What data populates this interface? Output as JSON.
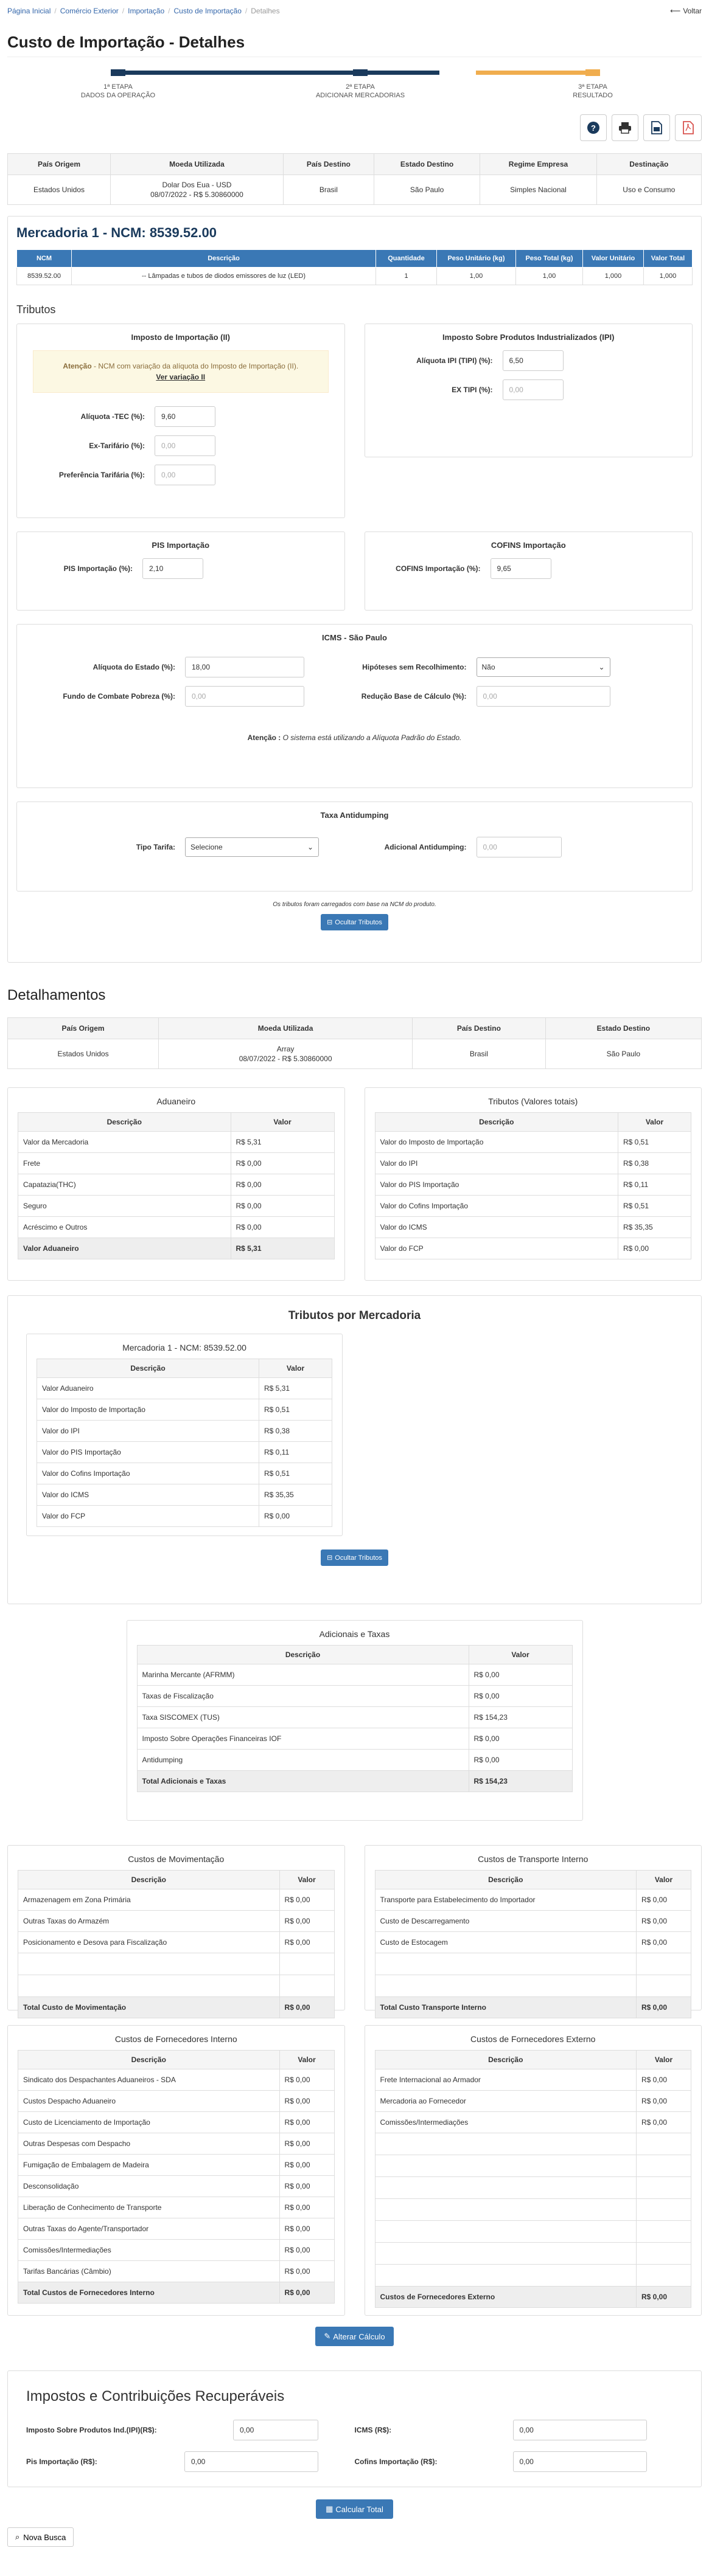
{
  "breadcrumb": [
    "Página Inicial",
    "Comércio Exterior",
    "Importação",
    "Custo de Importação",
    "Detalhes"
  ],
  "voltar_label": "Voltar",
  "page_title": "Custo de Importação - Detalhes",
  "steps": [
    {
      "step": "1ª ETAPA",
      "label": "DADOS DA OPERAÇÃO"
    },
    {
      "step": "2ª ETAPA",
      "label": "ADICIONAR MERCADORIAS"
    },
    {
      "step": "3ª ETAPA",
      "label": "RESULTADO"
    }
  ],
  "colors": {
    "step_done": "#1a3a5c",
    "step_current": "#f0ad4e",
    "primary": "#3a78b5",
    "pdf": "#d9534f"
  },
  "toolbar_icons": [
    "help-icon",
    "print-icon",
    "document-icon",
    "pdf-icon"
  ],
  "operation": {
    "headers": [
      "País Origem",
      "Moeda Utilizada",
      "País Destino",
      "Estado Destino",
      "Regime Empresa",
      "Destinação"
    ],
    "values": [
      "Estados Unidos",
      "Dolar Dos Eua - USD",
      "08/07/2022 - R$ 5.30860000",
      "Brasil",
      "São Paulo",
      "Simples Nacional",
      "Uso e Consumo"
    ]
  },
  "mercadoria": {
    "title": "Mercadoria 1 - NCM: 8539.52.00",
    "headers": [
      "NCM",
      "Descrição",
      "Quantidade",
      "Peso Unitário (kg)",
      "Peso Total (kg)",
      "Valor Unitário",
      "Valor Total"
    ],
    "row": [
      "8539.52.00",
      "-- Lâmpadas e tubos de diodos emissores de luz (LED)",
      "1",
      "1,00",
      "1,00",
      "1,000",
      "1,000"
    ]
  },
  "tributos": {
    "title": "Tributos",
    "ii": {
      "title": "Imposto de Importação (II)",
      "warn_prefix": "Atenção",
      "warn_text": " - NCM com variação da alíquota do Imposto de Importação (II).",
      "warn_link": "Ver variação II",
      "aliquota_label": "Alíquota -TEC (%):",
      "aliquota_value": "9,60",
      "ex_label": "Ex-Tarifário (%):",
      "ex_placeholder": "0,00",
      "pref_label": "Preferência Tarifária (%):",
      "pref_placeholder": "0,00"
    },
    "ipi": {
      "title": "Imposto Sobre Produtos Industrializados (IPI)",
      "aliquota_label": "Alíquota IPI (TIPI) (%):",
      "aliquota_value": "6,50",
      "ex_label": "EX TIPI (%):",
      "ex_placeholder": "0,00"
    },
    "pis": {
      "title": "PIS Importação",
      "label": "PIS Importação (%):",
      "value": "2,10"
    },
    "cofins": {
      "title": "COFINS Importação",
      "label": "COFINS Importação (%):",
      "value": "9,65"
    },
    "icms": {
      "title": "ICMS - São Paulo",
      "aliquota_label": "Alíquota do Estado (%):",
      "aliquota_value": "18,00",
      "hipoteses_label": "Hipóteses sem Recolhimento:",
      "hipoteses_value": "Não",
      "fcp_label": "Fundo de Combate Pobreza (%):",
      "fcp_placeholder": "0,00",
      "reducao_label": "Redução Base de Cálculo (%):",
      "reducao_placeholder": "0,00",
      "note_prefix": "Atenção :",
      "note_text": " O sistema está utilizando a Alíquota Padrão do Estado."
    },
    "antidumping": {
      "title": "Taxa Antidumping",
      "tipo_label": "Tipo Tarifa:",
      "tipo_value": "Selecione",
      "adicional_label": "Adicional Antidumping:",
      "adicional_placeholder": "0,00"
    },
    "footnote": "Os tributos foram carregados com base na NCM do produto.",
    "ocultar_label": "Ocultar Tributos"
  },
  "detalhamentos": {
    "title": "Detalhamentos",
    "headers": [
      "País Origem",
      "Moeda Utilizada",
      "País Destino",
      "Estado Destino"
    ],
    "values": [
      "Estados Unidos",
      "Array",
      "08/07/2022 - R$ 5.30860000",
      "Brasil",
      "São Paulo"
    ]
  },
  "aduaneiro": {
    "title": "Aduaneiro",
    "headers": [
      "Descrição",
      "Valor"
    ],
    "rows": [
      [
        "Valor da Mercadoria",
        "R$ 5,31"
      ],
      [
        "Frete",
        "R$ 0,00"
      ],
      [
        "Capatazia(THC)",
        "R$ 0,00"
      ],
      [
        "Seguro",
        "R$ 0,00"
      ],
      [
        "Acréscimo e Outros",
        "R$ 0,00"
      ]
    ],
    "total": [
      "Valor Aduaneiro",
      "R$ 5,31"
    ]
  },
  "tributos_totais": {
    "title": "Tributos (Valores totais)",
    "headers": [
      "Descrição",
      "Valor"
    ],
    "rows": [
      [
        "Valor do Imposto de Importação",
        "R$ 0,51"
      ],
      [
        "Valor do IPI",
        "R$ 0,38"
      ],
      [
        "Valor do PIS Importação",
        "R$ 0,11"
      ],
      [
        "Valor do Cofins Importação",
        "R$ 0,51"
      ],
      [
        "Valor do ICMS",
        "R$ 35,35"
      ],
      [
        "Valor do FCP",
        "R$ 0,00"
      ]
    ]
  },
  "tributos_mercadoria": {
    "title": "Tributos por Mercadoria",
    "card_title": "Mercadoria 1 - NCM: 8539.52.00",
    "headers": [
      "Descrição",
      "Valor"
    ],
    "rows": [
      [
        "Valor Aduaneiro",
        "R$ 5,31"
      ],
      [
        "Valor do Imposto de Importação",
        "R$ 0,51"
      ],
      [
        "Valor do IPI",
        "R$ 0,38"
      ],
      [
        "Valor do PIS Importação",
        "R$ 0,11"
      ],
      [
        "Valor do Cofins Importação",
        "R$ 0,51"
      ],
      [
        "Valor do ICMS",
        "R$ 35,35"
      ],
      [
        "Valor do FCP",
        "R$ 0,00"
      ]
    ],
    "ocultar_label": "Ocultar Tributos"
  },
  "adicionais": {
    "title": "Adicionais e Taxas",
    "headers": [
      "Descrição",
      "Valor"
    ],
    "rows": [
      [
        "Marinha Mercante (AFRMM)",
        "R$ 0,00"
      ],
      [
        "Taxas de Fiscalização",
        "R$ 0,00"
      ],
      [
        "Taxa SISCOMEX (TUS)",
        "R$ 154,23"
      ],
      [
        "Imposto Sobre Operações Financeiras IOF",
        "R$ 0,00"
      ],
      [
        "Antidumping",
        "R$ 0,00"
      ]
    ],
    "total": [
      "Total Adicionais e Taxas",
      "R$ 154,23"
    ]
  },
  "movimentacao": {
    "title": "Custos de Movimentação",
    "headers": [
      "Descrição",
      "Valor"
    ],
    "rows": [
      [
        "Armazenagem em Zona Primária",
        "R$ 0,00"
      ],
      [
        "Outras Taxas do Armazém",
        "R$ 0,00"
      ],
      [
        "Posicionamento e Desova para Fiscalização",
        "R$ 0,00"
      ]
    ],
    "total": [
      "Total Custo de Movimentação",
      "R$ 0,00"
    ]
  },
  "transporte": {
    "title": "Custos de Transporte Interno",
    "headers": [
      "Descrição",
      "Valor"
    ],
    "rows": [
      [
        "Transporte para Estabelecimento do Importador",
        "R$ 0,00"
      ],
      [
        "Custo de Descarregamento",
        "R$ 0,00"
      ],
      [
        "Custo de Estocagem",
        "R$ 0,00"
      ]
    ],
    "total": [
      "Total Custo Transporte Interno",
      "R$ 0,00"
    ]
  },
  "fornecedores_interno": {
    "title": "Custos de Fornecedores Interno",
    "headers": [
      "Descrição",
      "Valor"
    ],
    "rows": [
      [
        "Sindicato dos Despachantes Aduaneiros - SDA",
        "R$ 0,00"
      ],
      [
        "Custos Despacho Aduaneiro",
        "R$ 0,00"
      ],
      [
        "Custo de Licenciamento de Importação",
        "R$ 0,00"
      ],
      [
        "Outras Despesas com Despacho",
        "R$ 0,00"
      ],
      [
        "Fumigação de Embalagem de Madeira",
        "R$ 0,00"
      ],
      [
        "Desconsolidação",
        "R$ 0,00"
      ],
      [
        "Liberação de Conhecimento de Transporte",
        "R$ 0,00"
      ],
      [
        "Outras Taxas do Agente/Transportador",
        "R$ 0,00"
      ],
      [
        "Comissões/Intermediações",
        "R$ 0,00"
      ],
      [
        "Tarifas Bancárias (Câmbio)",
        "R$ 0,00"
      ]
    ],
    "total": [
      "Total Custos de Fornecedores Interno",
      "R$ 0,00"
    ]
  },
  "fornecedores_externo": {
    "title": "Custos de Fornecedores Externo",
    "headers": [
      "Descrição",
      "Valor"
    ],
    "rows": [
      [
        "Frete Internacional ao Armador",
        "R$ 0,00"
      ],
      [
        "Mercadoria ao Fornecedor",
        "R$ 0,00"
      ],
      [
        "Comissões/Intermediações",
        "R$ 0,00"
      ]
    ],
    "total": [
      "Custos de Fornecedores Externo",
      "R$ 0,00"
    ]
  },
  "alterar_label": "Alterar Cálculo",
  "recuperaveis": {
    "title": "Impostos e Contribuições Recuperáveis",
    "ipi_label": "Imposto Sobre Produtos Ind.(IPI)(R$):",
    "ipi_value": "0,00",
    "icms_label": "ICMS (R$):",
    "icms_value": "0,00",
    "pis_label": "Pis Importação (R$):",
    "pis_value": "0,00",
    "cofins_label": "Cofins Importação (R$):",
    "cofins_value": "0,00"
  },
  "calcular_label": "Calcular Total",
  "nova_busca_label": "Nova Busca"
}
